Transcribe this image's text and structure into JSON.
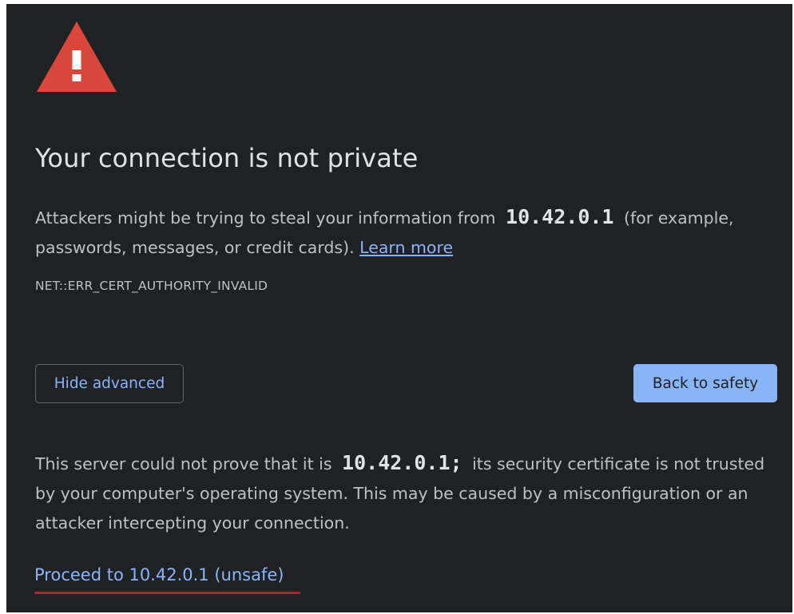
{
  "page": {
    "title": "Your connection is not private",
    "intro_before": "Attackers might be trying to steal your information from",
    "host": "10.42.0.1",
    "intro_after": "(for example, passwords, messages, or credit cards).",
    "learn_more": "Learn more",
    "error_code": "NET::ERR_CERT_AUTHORITY_INVALID"
  },
  "buttons": {
    "hide_advanced": "Hide advanced",
    "back_to_safety": "Back to safety"
  },
  "advanced": {
    "before": "This server could not prove that it is",
    "host": "10.42.0.1;",
    "after": "its security certificate is not trusted by your computer's operating system. This may be caused by a misconfiguration or an attacker intercepting your connection.",
    "proceed_link": "Proceed to 10.42.0.1 (unsafe)"
  },
  "colors": {
    "background": "#202125",
    "text": "#bdc1c6",
    "heading": "#dfe2e6",
    "link": "#8ab4f8",
    "primary_button": "#8ab4f8",
    "warning_icon": "#d8473b",
    "annotation_underline": "#d0172d"
  },
  "icons": {
    "warning": "warning-triangle-icon"
  }
}
